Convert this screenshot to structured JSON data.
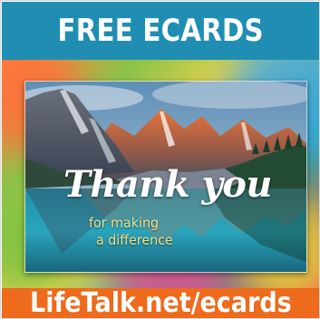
{
  "header": {
    "title": "FREE ECARDS",
    "background_color": "#1f8eb2"
  },
  "card": {
    "headline": "Thank you",
    "subline_1": "for making",
    "subline_2": "a difference",
    "headline_color": "#ffffff",
    "subline_color": "#f2e28a",
    "image": "mountain-lake-photo"
  },
  "footer": {
    "url_text": "LifeTalk.net/ecards",
    "background_color": "#ee6a1c"
  }
}
